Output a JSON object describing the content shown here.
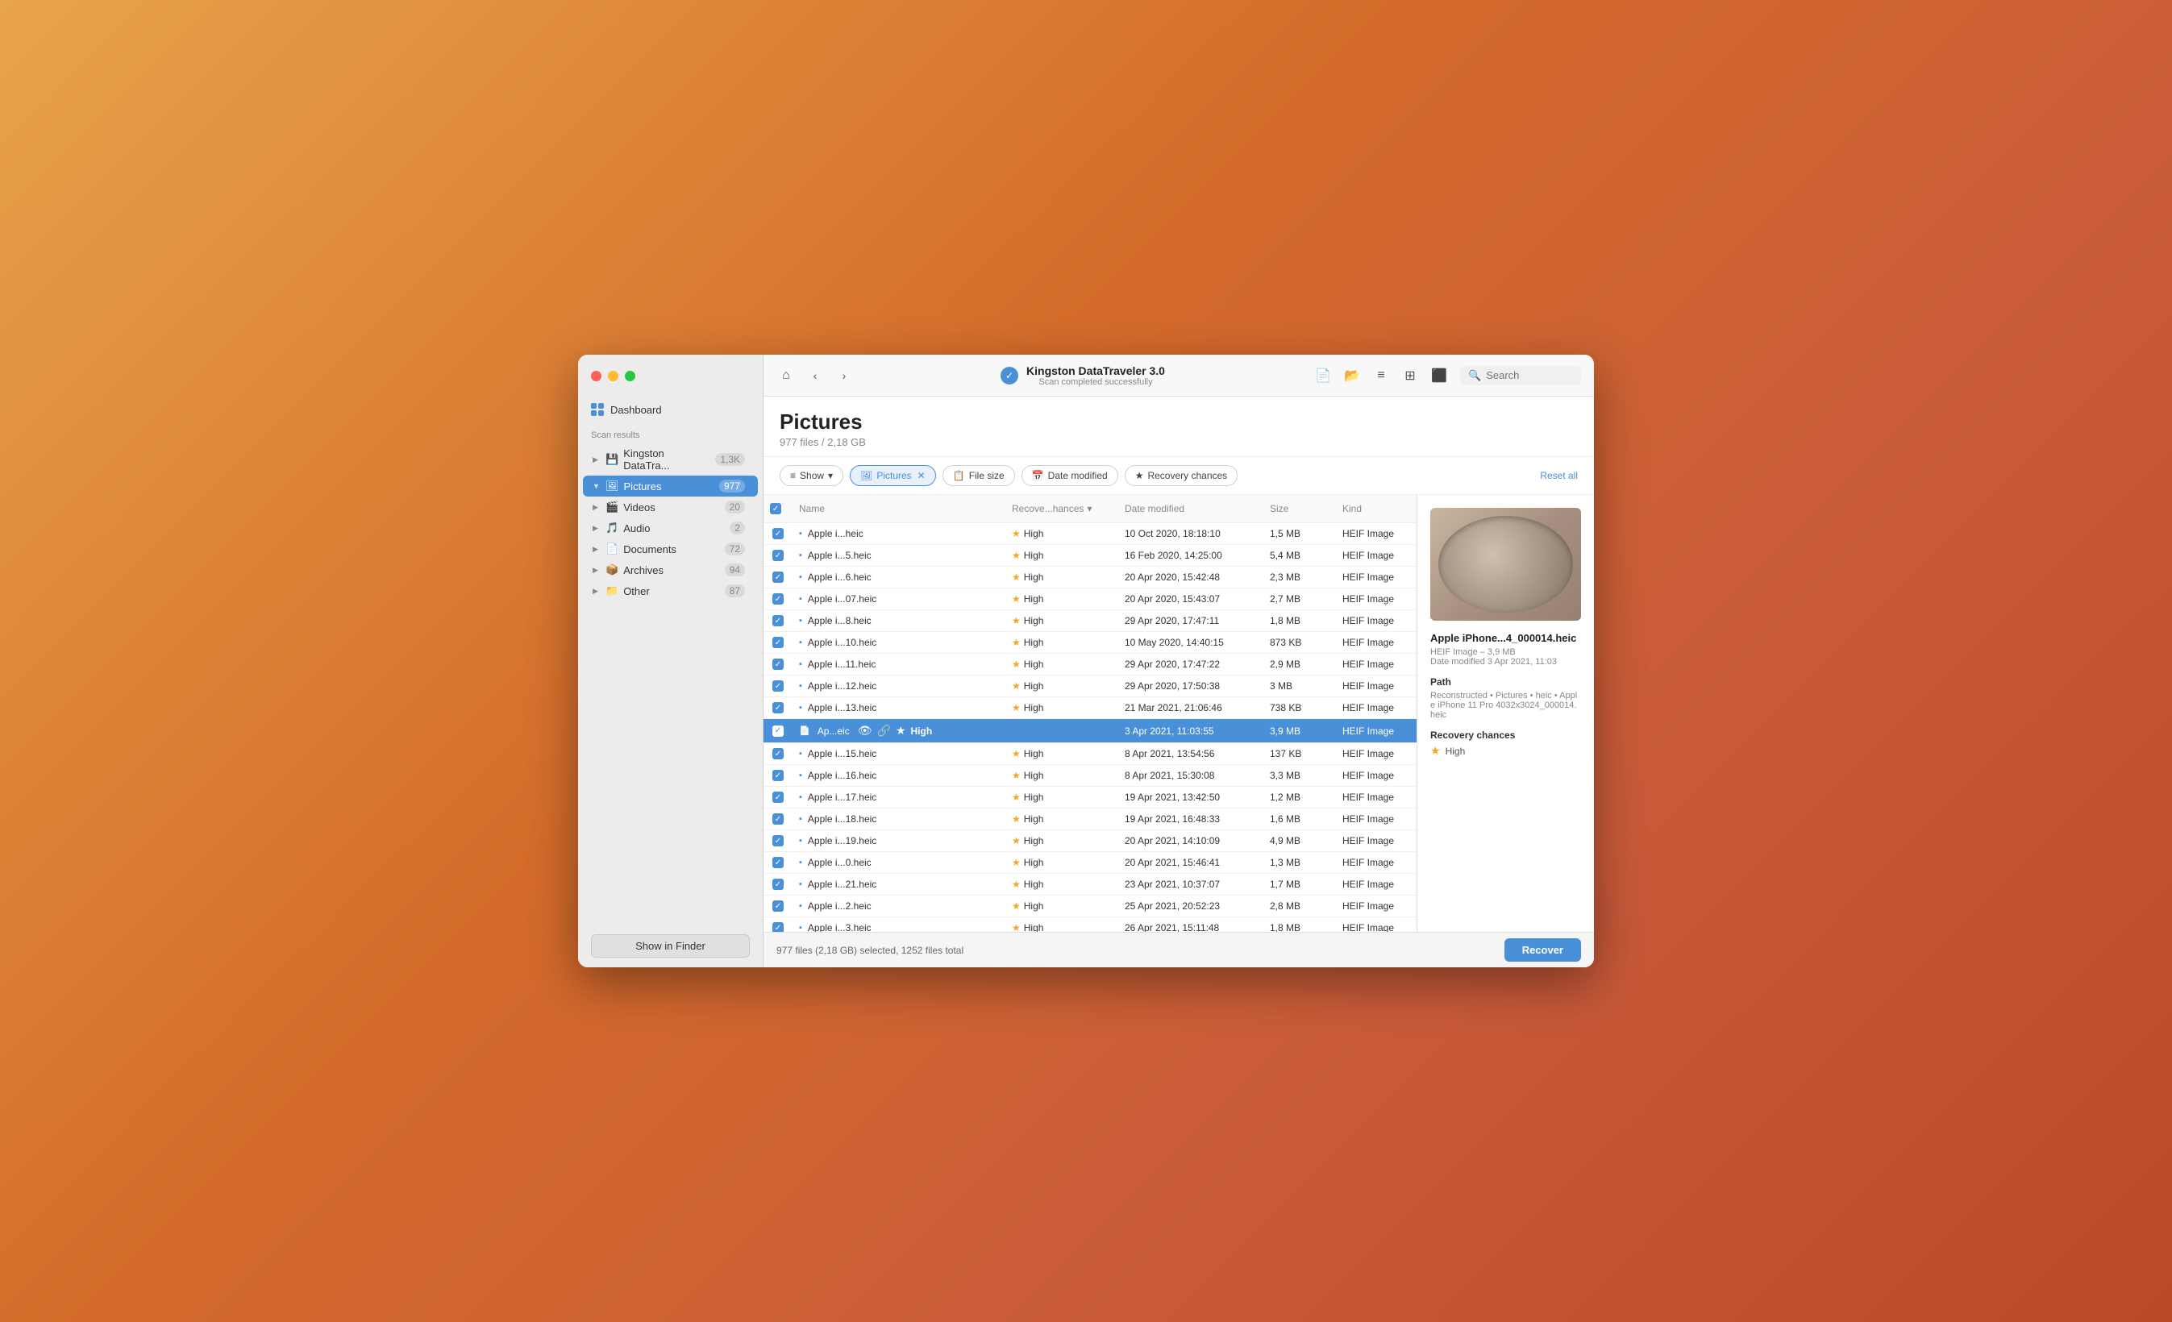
{
  "window": {
    "title": "Kingston DataTraveler 3.0",
    "status": "Scan completed successfully"
  },
  "sidebar": {
    "dashboard_label": "Dashboard",
    "scan_results_label": "Scan results",
    "items": [
      {
        "id": "kingston",
        "label": "Kingston DataTra...",
        "count": "1,3K",
        "icon": "💾",
        "active": false,
        "expanded": false
      },
      {
        "id": "pictures",
        "label": "Pictures",
        "count": "977",
        "icon": "🖼",
        "active": true,
        "expanded": true
      },
      {
        "id": "videos",
        "label": "Videos",
        "count": "20",
        "icon": "🎬",
        "active": false,
        "expanded": false
      },
      {
        "id": "audio",
        "label": "Audio",
        "count": "2",
        "icon": "🎵",
        "active": false,
        "expanded": false
      },
      {
        "id": "documents",
        "label": "Documents",
        "count": "72",
        "icon": "📄",
        "active": false,
        "expanded": false
      },
      {
        "id": "archives",
        "label": "Archives",
        "count": "94",
        "icon": "📦",
        "active": false,
        "expanded": false
      },
      {
        "id": "other",
        "label": "Other",
        "count": "87",
        "icon": "📁",
        "active": false,
        "expanded": false
      }
    ],
    "show_in_finder": "Show in Finder"
  },
  "toolbar": {
    "home_icon": "⌂",
    "back_icon": "‹",
    "forward_icon": "›",
    "search_placeholder": "Search",
    "search_value": ""
  },
  "page": {
    "title": "Pictures",
    "subtitle": "977 files / 2,18 GB"
  },
  "filters": {
    "show_label": "Show",
    "pictures_label": "Pictures",
    "file_size_label": "File size",
    "date_modified_label": "Date modified",
    "recovery_chances_label": "Recovery chances",
    "reset_all_label": "Reset all"
  },
  "table": {
    "columns": [
      "",
      "Name",
      "Recove...hances",
      "Date modified",
      "Size",
      "Kind"
    ],
    "rows": [
      {
        "name": "Apple i...heic",
        "recovery": "High",
        "date": "10 Oct 2020, 18:18:10",
        "size": "1,5 MB",
        "kind": "HEIF Image",
        "checked": true,
        "selected": false
      },
      {
        "name": "Apple i...5.heic",
        "recovery": "High",
        "date": "16 Feb 2020, 14:25:00",
        "size": "5,4 MB",
        "kind": "HEIF Image",
        "checked": true,
        "selected": false
      },
      {
        "name": "Apple i...6.heic",
        "recovery": "High",
        "date": "20 Apr 2020, 15:42:48",
        "size": "2,3 MB",
        "kind": "HEIF Image",
        "checked": true,
        "selected": false
      },
      {
        "name": "Apple i...07.heic",
        "recovery": "High",
        "date": "20 Apr 2020, 15:43:07",
        "size": "2,7 MB",
        "kind": "HEIF Image",
        "checked": true,
        "selected": false
      },
      {
        "name": "Apple i...8.heic",
        "recovery": "High",
        "date": "29 Apr 2020, 17:47:11",
        "size": "1,8 MB",
        "kind": "HEIF Image",
        "checked": true,
        "selected": false
      },
      {
        "name": "Apple i...10.heic",
        "recovery": "High",
        "date": "10 May 2020, 14:40:15",
        "size": "873 KB",
        "kind": "HEIF Image",
        "checked": true,
        "selected": false
      },
      {
        "name": "Apple i...11.heic",
        "recovery": "High",
        "date": "29 Apr 2020, 17:47:22",
        "size": "2,9 MB",
        "kind": "HEIF Image",
        "checked": true,
        "selected": false
      },
      {
        "name": "Apple i...12.heic",
        "recovery": "High",
        "date": "29 Apr 2020, 17:50:38",
        "size": "3 MB",
        "kind": "HEIF Image",
        "checked": true,
        "selected": false
      },
      {
        "name": "Apple i...13.heic",
        "recovery": "High",
        "date": "21 Mar 2021, 21:06:46",
        "size": "738 KB",
        "kind": "HEIF Image",
        "checked": true,
        "selected": false
      },
      {
        "name": "Ap...eic",
        "recovery": "High",
        "date": "3 Apr 2021, 11:03:55",
        "size": "3,9 MB",
        "kind": "HEIF Image",
        "checked": true,
        "selected": true
      },
      {
        "name": "Apple i...15.heic",
        "recovery": "High",
        "date": "8 Apr 2021, 13:54:56",
        "size": "137 KB",
        "kind": "HEIF Image",
        "checked": true,
        "selected": false
      },
      {
        "name": "Apple i...16.heic",
        "recovery": "High",
        "date": "8 Apr 2021, 15:30:08",
        "size": "3,3 MB",
        "kind": "HEIF Image",
        "checked": true,
        "selected": false
      },
      {
        "name": "Apple i...17.heic",
        "recovery": "High",
        "date": "19 Apr 2021, 13:42:50",
        "size": "1,2 MB",
        "kind": "HEIF Image",
        "checked": true,
        "selected": false
      },
      {
        "name": "Apple i...18.heic",
        "recovery": "High",
        "date": "19 Apr 2021, 16:48:33",
        "size": "1,6 MB",
        "kind": "HEIF Image",
        "checked": true,
        "selected": false
      },
      {
        "name": "Apple i...19.heic",
        "recovery": "High",
        "date": "20 Apr 2021, 14:10:09",
        "size": "4,9 MB",
        "kind": "HEIF Image",
        "checked": true,
        "selected": false
      },
      {
        "name": "Apple i...0.heic",
        "recovery": "High",
        "date": "20 Apr 2021, 15:46:41",
        "size": "1,3 MB",
        "kind": "HEIF Image",
        "checked": true,
        "selected": false
      },
      {
        "name": "Apple i...21.heic",
        "recovery": "High",
        "date": "23 Apr 2021, 10:37:07",
        "size": "1,7 MB",
        "kind": "HEIF Image",
        "checked": true,
        "selected": false
      },
      {
        "name": "Apple i...2.heic",
        "recovery": "High",
        "date": "25 Apr 2021, 20:52:23",
        "size": "2,8 MB",
        "kind": "HEIF Image",
        "checked": true,
        "selected": false
      },
      {
        "name": "Apple i...3.heic",
        "recovery": "High",
        "date": "26 Apr 2021, 15:11:48",
        "size": "1,8 MB",
        "kind": "HEIF Image",
        "checked": true,
        "selected": false
      }
    ]
  },
  "detail": {
    "filename": "Apple iPhone...4_000014.heic",
    "meta": "HEIF Image – 3,9 MB",
    "date_label": "Date modified",
    "date_value": "3 Apr 2021, 11:03",
    "path_label": "Path",
    "path_value": "Reconstructed • Pictures • heic • Apple iPhone 11 Pro 4032x3024_000014.heic",
    "recovery_label": "Recovery chances",
    "recovery_value": "High"
  },
  "bottom": {
    "status": "977 files (2,18 GB) selected, 1252 files total",
    "recover_label": "Recover"
  }
}
